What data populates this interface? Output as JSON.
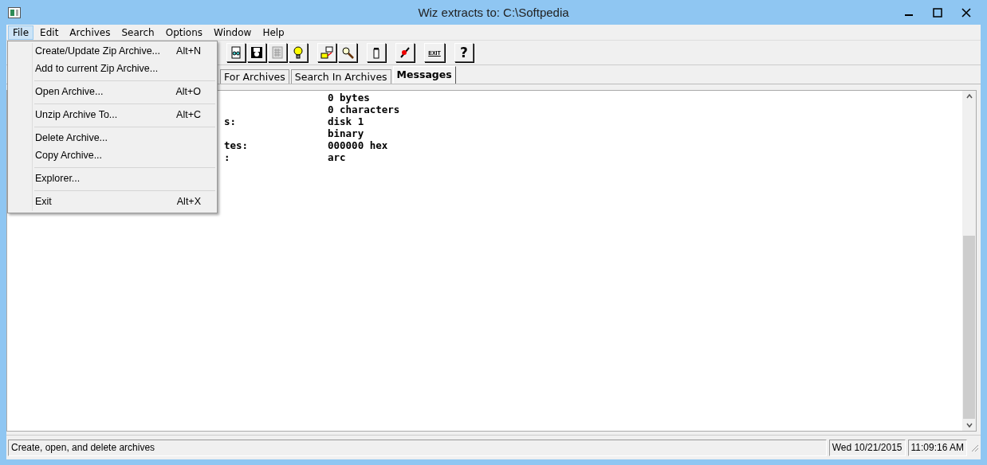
{
  "window": {
    "title": "Wiz extracts to: C:\\Softpedia"
  },
  "menu_bar": [
    {
      "label": "File",
      "selected": true
    },
    {
      "label": "Edit",
      "selected": false
    },
    {
      "label": "Archives",
      "selected": false
    },
    {
      "label": "Search",
      "selected": false
    },
    {
      "label": "Options",
      "selected": false
    },
    {
      "label": "Window",
      "selected": false
    },
    {
      "label": "Help",
      "selected": false
    }
  ],
  "file_menu": [
    [
      {
        "label": "Create/Update Zip Archive...",
        "shortcut": "Alt+N"
      },
      {
        "label": "Add to current Zip Archive..."
      }
    ],
    [
      {
        "label": "Open Archive...",
        "shortcut": "Alt+O"
      }
    ],
    [
      {
        "label": "Unzip Archive To...",
        "shortcut": "Alt+C"
      }
    ],
    [
      {
        "label": "Delete Archive..."
      },
      {
        "label": "Copy Archive..."
      }
    ],
    [
      {
        "label": "Explorer..."
      }
    ],
    [
      {
        "label": "Exit",
        "shortcut": "Alt+X"
      }
    ]
  ],
  "toolbar": {
    "exit_label": "EXIT",
    "help_label": "?"
  },
  "tabs": [
    {
      "label": "For Archives",
      "selected": false
    },
    {
      "label": "Search In Archives",
      "selected": false
    },
    {
      "label": "Messages",
      "selected": true
    }
  ],
  "messages": [
    {
      "value": "0 bytes"
    },
    {
      "value": "0 characters"
    },
    {
      "label": "s:",
      "value": "disk 1"
    },
    {
      "value": "binary"
    },
    {
      "label": "tes:",
      "value": "000000 hex"
    },
    {
      "label": ":",
      "value": "arc"
    }
  ],
  "status_bar": {
    "message": "Create, open, and delete archives",
    "date": "Wed 10/21/2015",
    "time": "11:09:16 AM"
  }
}
